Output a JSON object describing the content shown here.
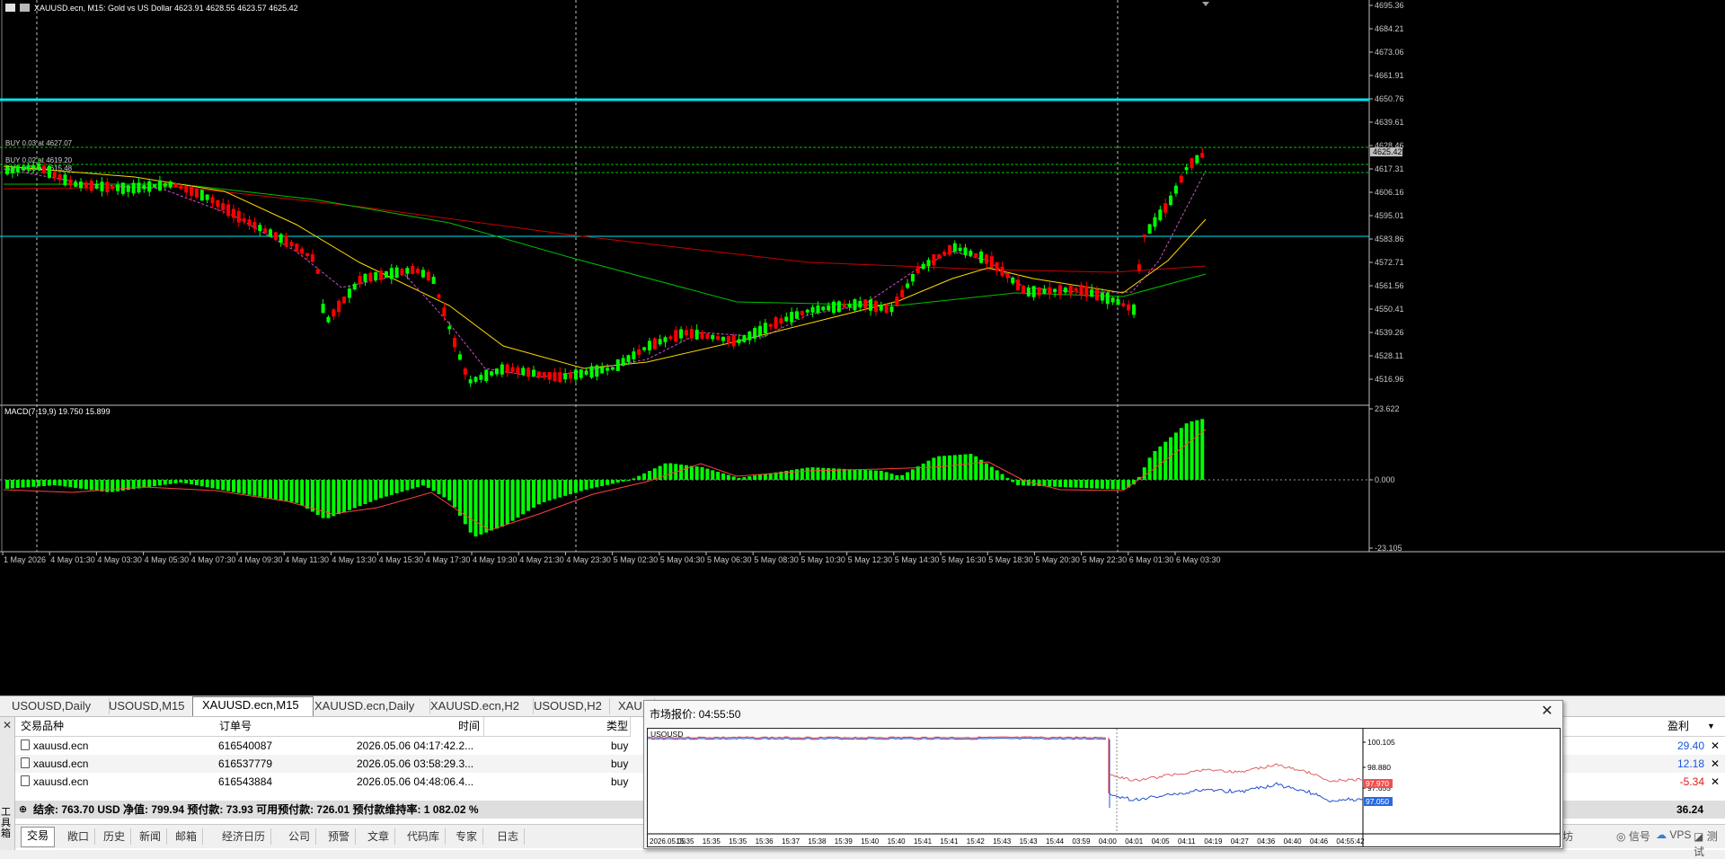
{
  "chart": {
    "header_title": "XAUUSD.ecn, M15:  Gold vs US Dollar  4623.91 4628.55 4623.57 4625.42",
    "order_lines": [
      "BUY 0.03 at 4627.07",
      "BUY 0.02 at 4619.20",
      "BUY 0.03 at 4615.48"
    ],
    "price_labels": [
      "4695.36",
      "4684.21",
      "4673.06",
      "4661.91",
      "4650.76",
      "4639.61",
      "4628.46",
      "4617.31",
      "4606.16",
      "4595.01",
      "4583.86",
      "4572.71",
      "4561.56",
      "4550.41",
      "4539.26",
      "4528.11",
      "4516.96"
    ],
    "current_price": "4625.42",
    "macd_label": "MACD(7,19,9) 19.750 15.899",
    "macd_labels": [
      "23.622",
      "0.000",
      "-23.105"
    ],
    "time_labels": [
      "1 May 2026",
      "4 May 01:30",
      "4 May 03:30",
      "4 May 05:30",
      "4 May 07:30",
      "4 May 09:30",
      "4 May 11:30",
      "4 May 13:30",
      "4 May 15:30",
      "4 May 17:30",
      "4 May 19:30",
      "4 May 21:30",
      "4 May 23:30",
      "5 May 02:30",
      "5 May 04:30",
      "5 May 06:30",
      "5 May 08:30",
      "5 May 10:30",
      "5 May 12:30",
      "5 May 14:30",
      "5 May 16:30",
      "5 May 18:30",
      "5 May 20:30",
      "5 May 22:30",
      "6 May 01:30",
      "6 May 03:30"
    ],
    "colors": {
      "bull": "#00ff00",
      "bear": "#ff0000",
      "ma_fast": "#ffd800",
      "ma_mid": "#00c000",
      "ma_slow": "#c80000",
      "level_line": "#00e5ee",
      "signal": "#ff4040"
    }
  },
  "chart_tabs": [
    "USOUSD,Daily",
    "USOUSD,M15",
    "XAUUSD.ecn,M15",
    "XAUUSD.ecn,Daily",
    "XAUUSD.ecn,H2",
    "USOUSD,H2",
    "XAU"
  ],
  "terminal": {
    "side_label": "工具箱",
    "columns": {
      "symbol": "交易品种",
      "order": "订单号",
      "time": "时间",
      "type": "类型",
      "profit": "盈利"
    },
    "rows": [
      {
        "symbol": "xauusd.ecn",
        "order": "616540087",
        "time": "2026.05.06 04:17:42.2...",
        "type": "buy",
        "profit": "29.40",
        "profit_color": "#1a56db"
      },
      {
        "symbol": "xauusd.ecn",
        "order": "616537779",
        "time": "2026.05.06 03:58:29.3...",
        "type": "buy",
        "profit": "12.18",
        "profit_color": "#1a56db"
      },
      {
        "symbol": "xauusd.ecn",
        "order": "616543884",
        "time": "2026.05.06 04:48:06.4...",
        "type": "buy",
        "profit": "-5.34",
        "profit_color": "#e0191b"
      }
    ],
    "balance_text": "结余: 763.70 USD  净值: 799.94  预付款: 73.93  可用预付款: 726.01  预付款维持率: 1 082.02 %",
    "total_profit": "36.24",
    "tabs": [
      "交易",
      "敞口",
      "历史",
      "新闻",
      "邮箱",
      "经济日历",
      "公司",
      "预警",
      "文章",
      "代码库",
      "专家",
      "日志"
    ],
    "status_items": [
      "坊",
      "信号",
      "VPS",
      "测试"
    ]
  },
  "popup": {
    "title": "市场报价: 04:55:50",
    "symbol": "USOUSD",
    "price_labels": [
      "100.105",
      "98.880",
      "97.655"
    ],
    "ask": "97.970",
    "bid": "97.050",
    "time_labels": [
      "2026.05.05",
      "15:35",
      "15:35",
      "15:35",
      "15:36",
      "15:37",
      "15:38",
      "15:39",
      "15:40",
      "15:40",
      "15:41",
      "15:41",
      "15:42",
      "15:43",
      "15:43",
      "15:44",
      "03:59",
      "04:00",
      "04:01",
      "04:05",
      "04:11",
      "04:19",
      "04:27",
      "04:36",
      "04:40",
      "04:46",
      "04:55:42"
    ]
  }
}
